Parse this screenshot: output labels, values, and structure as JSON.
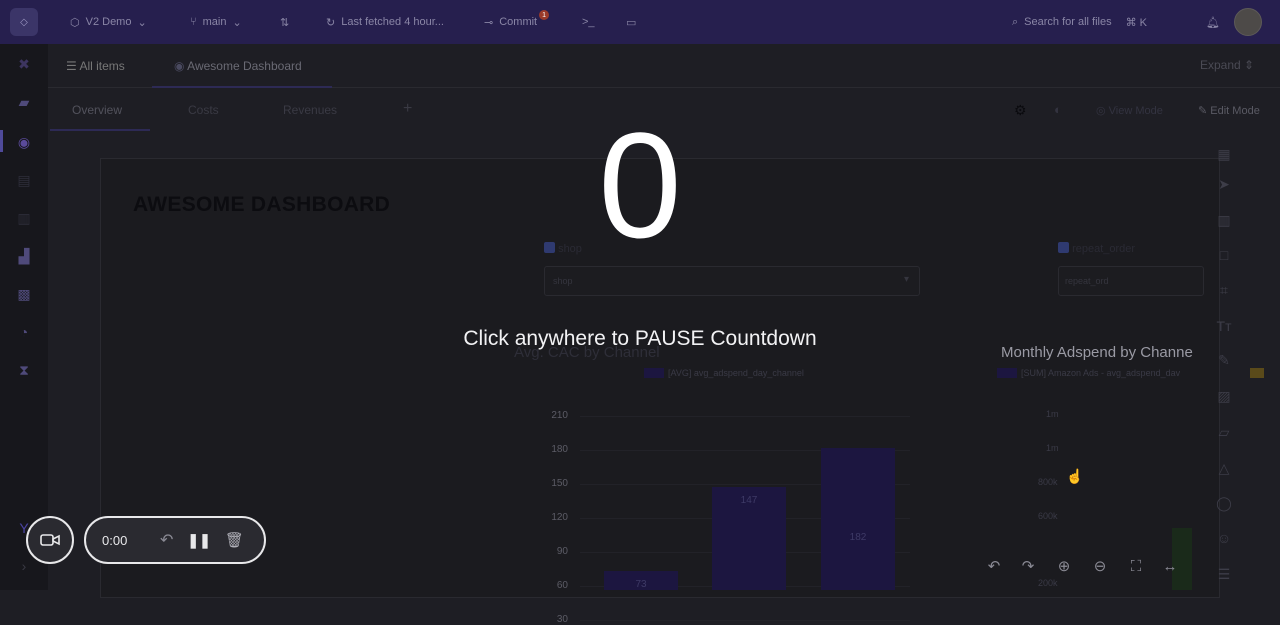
{
  "topbar": {
    "project": "V2 Demo",
    "branch": "main",
    "fetch_status": "Last fetched 4 hour...",
    "commit_label": "Commit",
    "commit_badge": "1",
    "search_placeholder": "Search for all files",
    "search_shortcut": "⌘ K"
  },
  "tabs": {
    "all_items": "All items",
    "dashboard": "Awesome Dashboard",
    "expand": "Expand"
  },
  "subtabs": {
    "items": [
      "Overview",
      "Costs",
      "Revenues"
    ],
    "add": "+",
    "view_mode": "View Mode",
    "edit_mode": "Edit Mode"
  },
  "dashboard": {
    "title": "AWESOME DASHBOARD",
    "filters": [
      {
        "label": "shop",
        "placeholder": "shop"
      },
      {
        "label": "repeat_order",
        "placeholder": "repeat_ord"
      }
    ]
  },
  "charts": {
    "cac": {
      "title": "Avg. CAC by Channel",
      "legend": "[AVG] avg_adspend_day_channel",
      "y_ticks": [
        "210",
        "180",
        "150",
        "120",
        "90",
        "60",
        "30"
      ]
    },
    "adspend": {
      "title": "Monthly Adspend by Channe",
      "legend": "[SUM] Amazon Ads - avg_adspend_dav",
      "y_ticks": [
        "1m",
        "1m",
        "800k",
        "600k",
        "200k"
      ]
    }
  },
  "chart_data": {
    "type": "bar",
    "title": "Avg. CAC by Channel",
    "series": [
      {
        "name": "[AVG] avg_adspend_day_channel",
        "values": [
          73,
          147,
          182
        ]
      }
    ],
    "ylim": [
      0,
      210
    ],
    "yticks": [
      30,
      60,
      90,
      120,
      150,
      180,
      210
    ]
  },
  "overlay": {
    "countdown": "0",
    "message": "Click anywhere to PAUSE Countdown"
  },
  "recorder": {
    "time": "0:00"
  },
  "colors": {
    "topbar": "#261f4e",
    "bar": "#1c1640",
    "overlay_text": "#ffffff"
  }
}
